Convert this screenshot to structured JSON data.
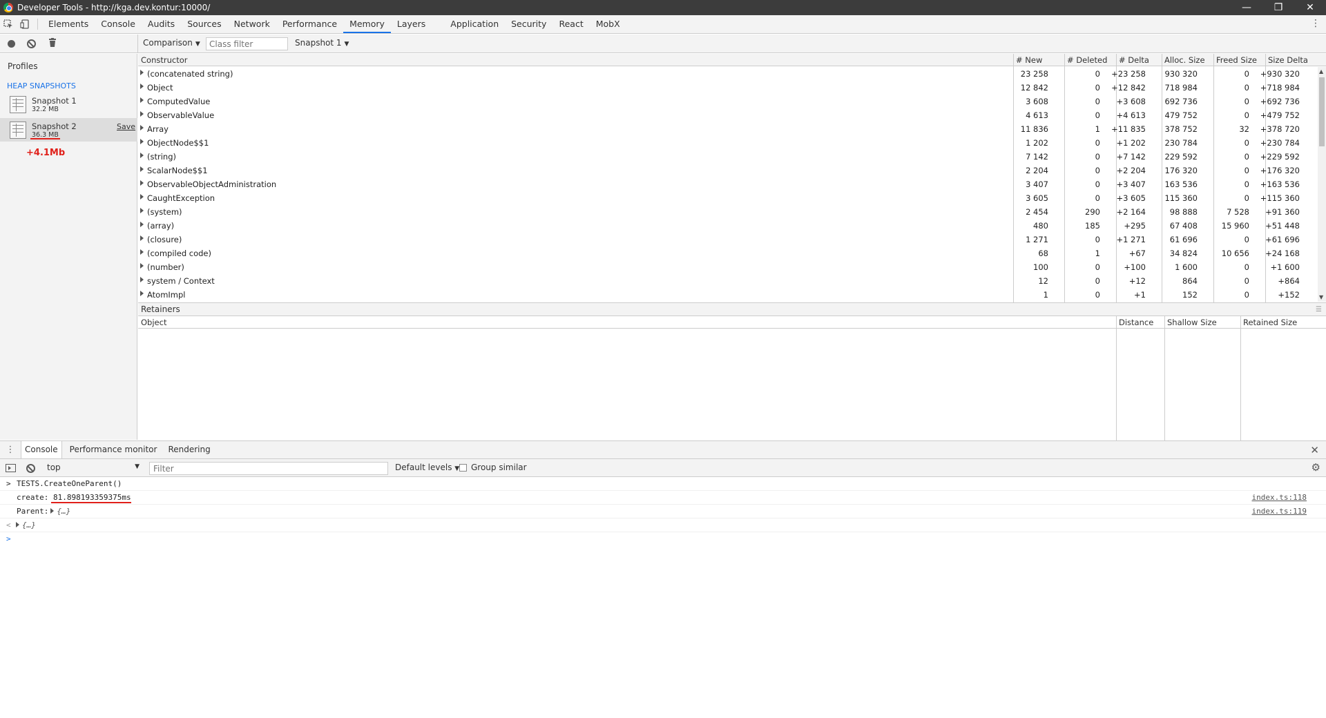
{
  "window": {
    "title": "Developer Tools - http://kga.dev.kontur:10000/",
    "controls": [
      "—",
      "❐",
      "✕"
    ]
  },
  "tabs": [
    "Elements",
    "Console",
    "Audits",
    "Sources",
    "Network",
    "Performance",
    "Memory",
    "Layers",
    "Application",
    "Security",
    "React",
    "MobX"
  ],
  "active_tab": "Memory",
  "memory_toolbar": {
    "view_mode": "Comparison",
    "class_filter_placeholder": "Class filter",
    "base_snapshot": "Snapshot 1"
  },
  "sidebar": {
    "profiles_title": "Profiles",
    "section_title": "HEAP SNAPSHOTS",
    "snapshots": [
      {
        "name": "Snapshot 1",
        "size": "32.2 MB"
      },
      {
        "name": "Snapshot 2",
        "size": "36.3 MB",
        "action": "Save"
      }
    ],
    "note": "+4.1Mb"
  },
  "heap_table": {
    "columns": [
      "Constructor",
      "# New",
      "# Deleted",
      "# Delta",
      "Alloc. Size",
      "Freed Size",
      "Size Delta"
    ],
    "rows": [
      [
        "(concatenated string)",
        "23 258",
        "0",
        "+23 258",
        "930 320",
        "0",
        "+930 320"
      ],
      [
        "Object",
        "12 842",
        "0",
        "+12 842",
        "718 984",
        "0",
        "+718 984"
      ],
      [
        "ComputedValue",
        "3 608",
        "0",
        "+3 608",
        "692 736",
        "0",
        "+692 736"
      ],
      [
        "ObservableValue",
        "4 613",
        "0",
        "+4 613",
        "479 752",
        "0",
        "+479 752"
      ],
      [
        "Array",
        "11 836",
        "1",
        "+11 835",
        "378 752",
        "32",
        "+378 720"
      ],
      [
        "ObjectNode$$1",
        "1 202",
        "0",
        "+1 202",
        "230 784",
        "0",
        "+230 784"
      ],
      [
        "(string)",
        "7 142",
        "0",
        "+7 142",
        "229 592",
        "0",
        "+229 592"
      ],
      [
        "ScalarNode$$1",
        "2 204",
        "0",
        "+2 204",
        "176 320",
        "0",
        "+176 320"
      ],
      [
        "ObservableObjectAdministration",
        "3 407",
        "0",
        "+3 407",
        "163 536",
        "0",
        "+163 536"
      ],
      [
        "CaughtException",
        "3 605",
        "0",
        "+3 605",
        "115 360",
        "0",
        "+115 360"
      ],
      [
        "(system)",
        "2 454",
        "290",
        "+2 164",
        "98 888",
        "7 528",
        "+91 360"
      ],
      [
        "(array)",
        "480",
        "185",
        "+295",
        "67 408",
        "15 960",
        "+51 448"
      ],
      [
        "(closure)",
        "1 271",
        "0",
        "+1 271",
        "61 696",
        "0",
        "+61 696"
      ],
      [
        "(compiled code)",
        "68",
        "1",
        "+67",
        "34 824",
        "10 656",
        "+24 168"
      ],
      [
        "(number)",
        "100",
        "0",
        "+100",
        "1 600",
        "0",
        "+1 600"
      ],
      [
        "system / Context",
        "12",
        "0",
        "+12",
        "864",
        "0",
        "+864"
      ],
      [
        "AtomImpl",
        "1",
        "0",
        "+1",
        "152",
        "0",
        "+152"
      ]
    ]
  },
  "retainers": {
    "title": "Retainers",
    "columns": [
      "Object",
      "Distance",
      "Shallow Size",
      "Retained Size"
    ]
  },
  "drawer": {
    "tabs": [
      "Console",
      "Performance monitor",
      "Rendering"
    ],
    "active_tab": "Console",
    "context": "top",
    "filter_placeholder": "Filter",
    "levels": "Default levels",
    "group_similar": "Group similar"
  },
  "console_lines": [
    {
      "prefix": ">",
      "text": "TESTS.CreateOneParent()"
    },
    {
      "label": "create:",
      "value": "81.898193359375ms",
      "source": "index.ts:118"
    },
    {
      "label": "Parent:",
      "value": "{…}",
      "source": "index.ts:119"
    },
    {
      "prefix": "<",
      "value": "{…}"
    },
    {
      "prefix": ">"
    }
  ]
}
